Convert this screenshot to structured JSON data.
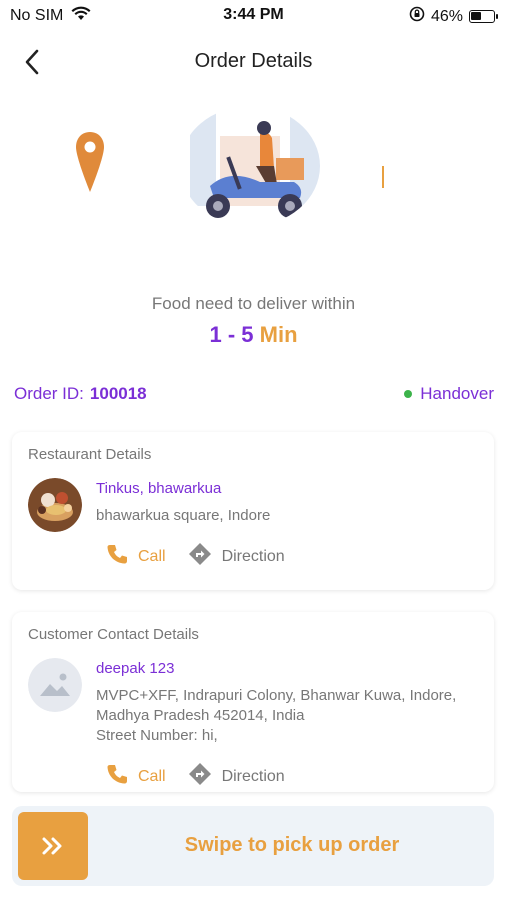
{
  "status_bar": {
    "carrier": "No SIM",
    "time": "3:44 PM",
    "battery_percent": "46%",
    "battery_level": 0.46
  },
  "header": {
    "title": "Order Details"
  },
  "delivery": {
    "message": "Food need to deliver within",
    "range": "1 - 5",
    "unit": "Min"
  },
  "order": {
    "id_label": "Order ID:",
    "id_value": "100018",
    "status": "Handover",
    "status_color": "#3cb34a"
  },
  "restaurant": {
    "section_title": "Restaurant Details",
    "name": "Tinkus, bhawarkua",
    "address": "bhawarkua square, Indore",
    "call_label": "Call",
    "direction_label": "Direction"
  },
  "customer": {
    "section_title": "Customer Contact Details",
    "name": "deepak 123",
    "address_line1": "MVPC+XFF, Indrapuri Colony, Bhanwar Kuwa, Indore,",
    "address_line2": "Madhya Pradesh 452014, India",
    "street": "Street Number: hi,",
    "call_label": "Call",
    "direction_label": "Direction"
  },
  "swipe": {
    "label": "Swipe to pick up order",
    "handle_icon": "double-chevron-right-icon"
  },
  "colors": {
    "accent_purple": "#7b2fd6",
    "accent_orange": "#e8a040",
    "muted_text": "#777777"
  }
}
